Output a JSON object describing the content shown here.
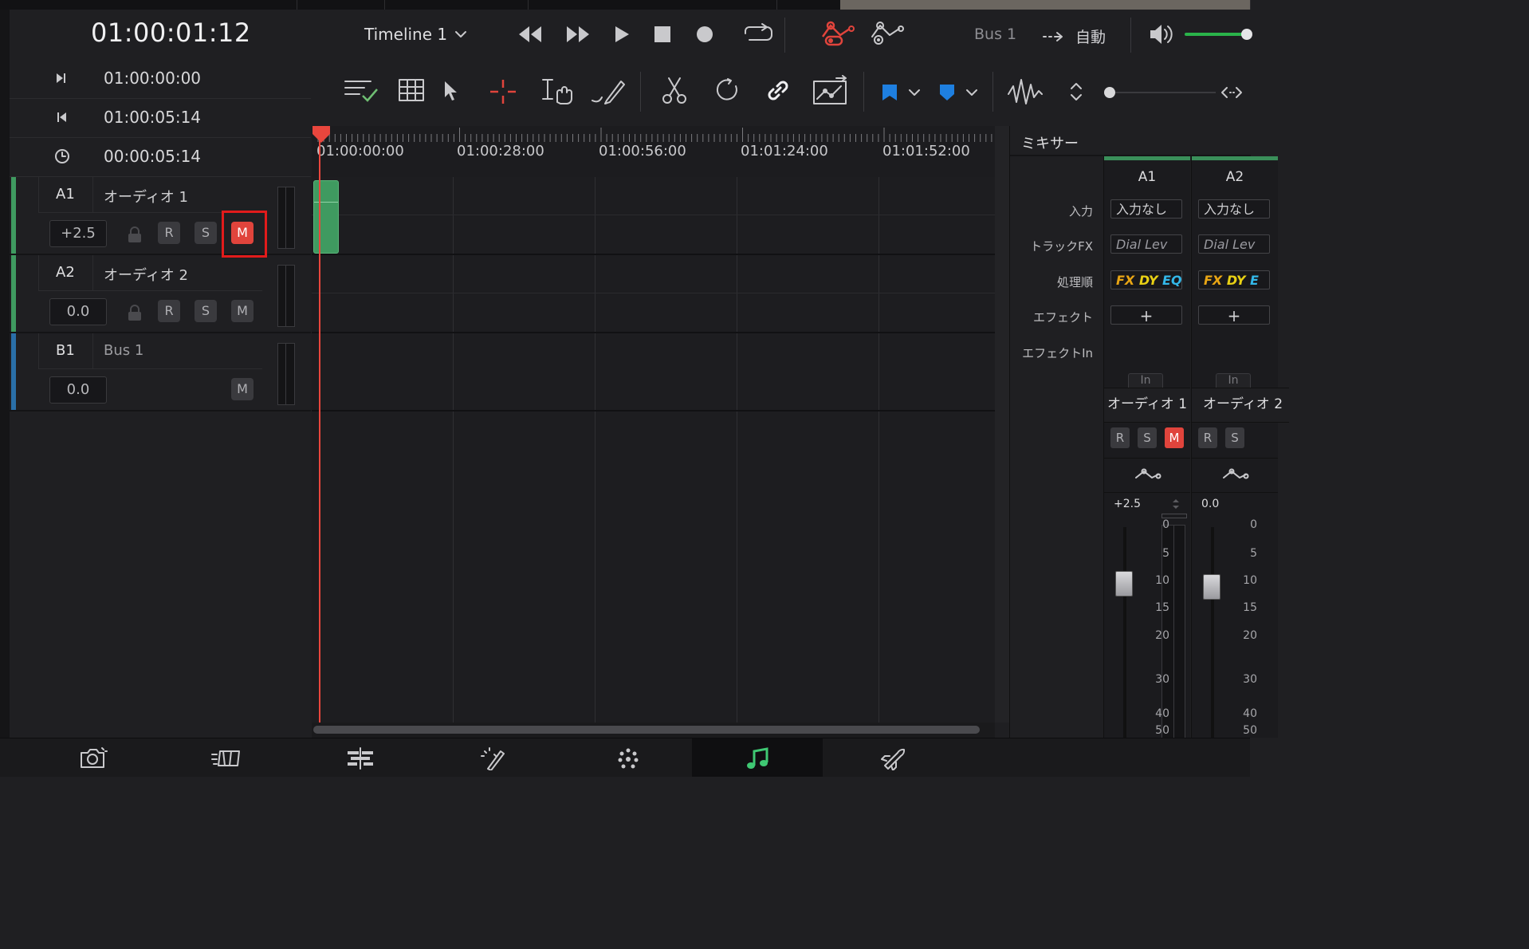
{
  "header": {
    "timecode": "01:00:01:12",
    "timeline_name": "Timeline 1",
    "bus_label": "Bus 1",
    "auto_label": "自動"
  },
  "timecodes": {
    "in": "01:00:00:00",
    "out": "01:00:05:14",
    "duration": "00:00:05:14"
  },
  "tracks": [
    {
      "id": "A1",
      "name": "オーディオ 1",
      "volume": "+2.5",
      "buttons": [
        "R",
        "S",
        "M"
      ],
      "mute_active": true,
      "color": "#3f9a60"
    },
    {
      "id": "A2",
      "name": "オーディオ 2",
      "volume": "0.0",
      "buttons": [
        "R",
        "S",
        "M"
      ],
      "mute_active": false,
      "color": "#3f9a60"
    },
    {
      "id": "B1",
      "name": "Bus 1",
      "volume": "0.0",
      "buttons": [
        "M"
      ],
      "mute_active": false,
      "color": "#2a6fa8"
    }
  ],
  "ruler": {
    "labels": [
      "01:00:00:00",
      "01:00:28:00",
      "01:00:56:00",
      "01:01:24:00",
      "01:01:52:00"
    ]
  },
  "mixer": {
    "title": "ミキサー",
    "row_labels": {
      "input": "入力",
      "track_fx": "トラックFX",
      "order": "処理順",
      "effects": "エフェクト",
      "effects_in": "エフェクトIn"
    },
    "channels": [
      {
        "id": "A1",
        "input": "入力なし",
        "track_fx": "Dial Lev",
        "order_fx": "FX",
        "order_dy": "DY",
        "order_eq": "EQ",
        "effects": "+",
        "effects_in": "In",
        "track_name": "オーディオ 1",
        "fader_value": "+2.5",
        "fader_level": 0.62,
        "mute_active": true
      },
      {
        "id": "A2",
        "input": "入力なし",
        "track_fx": "Dial Lev",
        "order_fx": "FX",
        "order_dy": "DY",
        "order_eq": "E",
        "effects": "+",
        "effects_in": "In",
        "track_name": "オーディオ 2",
        "fader_value": "0.0",
        "fader_level": 0.55,
        "mute_active": false
      }
    ],
    "scale": [
      "0",
      "5",
      "10",
      "15",
      "20",
      "30",
      "40",
      "50"
    ],
    "buttons": [
      "R",
      "S",
      "M"
    ]
  },
  "colors": {
    "accent_red": "#e0443c",
    "clip_green": "#3f9a60",
    "bus_blue": "#2a6fa8"
  },
  "bottom_pages": [
    "media-icon",
    "cut-icon",
    "edit-icon",
    "color-icon",
    "fusion-icon",
    "fairlight-icon",
    "deliver-icon"
  ],
  "active_page": "fairlight-icon"
}
